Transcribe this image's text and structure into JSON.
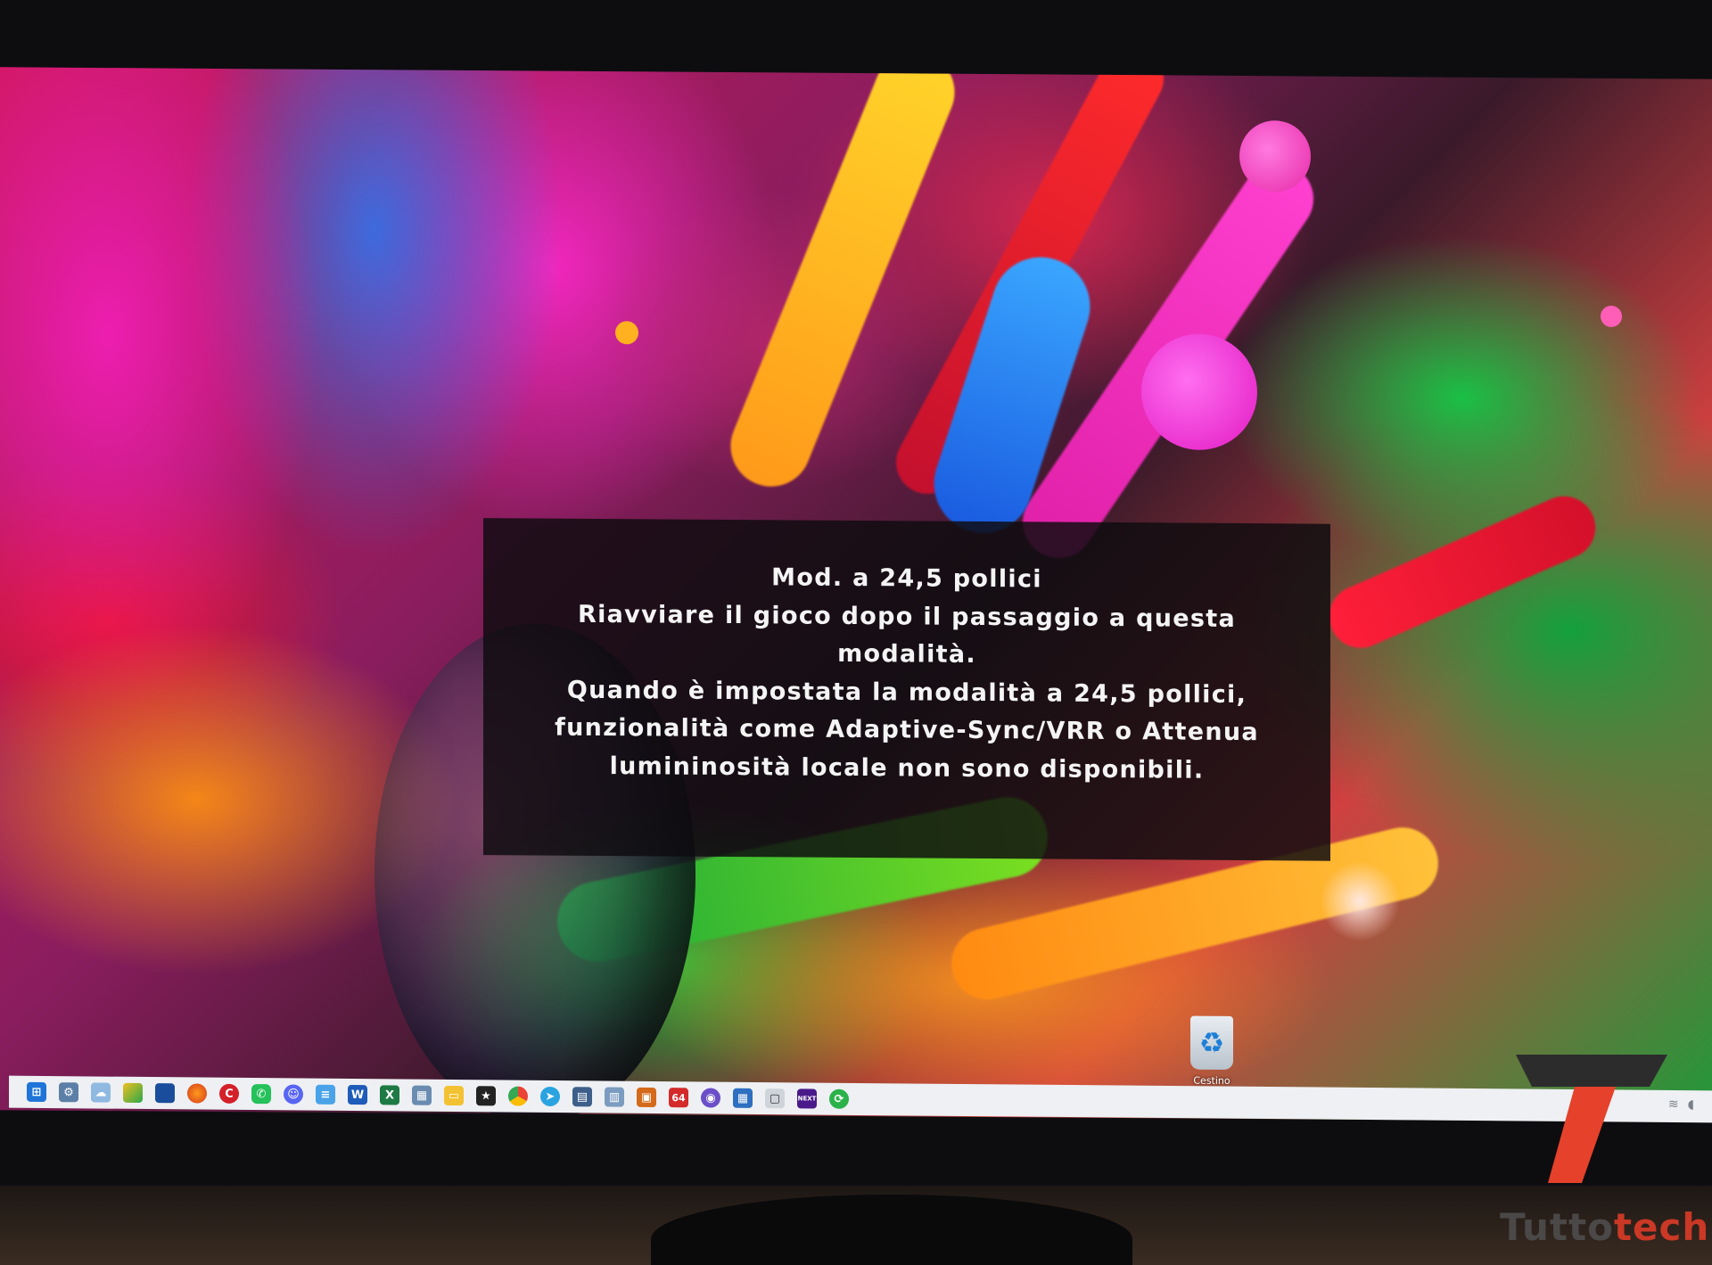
{
  "dialog": {
    "lines": [
      "Mod. a 24,5 pollici",
      "Riavviare il gioco dopo il passaggio a questa",
      "modalità.",
      "Quando è impostata la modalità a 24,5 pollici,",
      "funzionalità come Adaptive-Sync/VRR o Attenua",
      "lumininosità locale non sono disponibili."
    ]
  },
  "desktop": {
    "recycle_bin_label": "Cestino"
  },
  "taskbar": {
    "icons": [
      "windows-start-icon",
      "settings-icon",
      "cloud-icon",
      "notes-icon",
      "app-icon",
      "firefox-icon",
      "ccleaner-icon",
      "whatsapp-icon",
      "discord-icon",
      "notepad-icon",
      "word-icon",
      "excel-icon",
      "calculator-icon",
      "file-explorer-icon",
      "media-icon",
      "chrome-icon",
      "telegram-icon",
      "app-icon",
      "app-icon",
      "app-icon",
      "app-icon",
      "app-icon",
      "app-icon",
      "app-icon",
      "app-icon",
      "app-icon"
    ],
    "badge_64": "64",
    "badge_next": "NEXT"
  },
  "watermark": {
    "part1": "Tutto",
    "part2": "tech"
  },
  "colors": {
    "dialog_bg": "#0e0c10",
    "dialog_text": "#f4f4f4",
    "logo_dark": "#2c2c2c",
    "logo_red": "#e5412b"
  }
}
